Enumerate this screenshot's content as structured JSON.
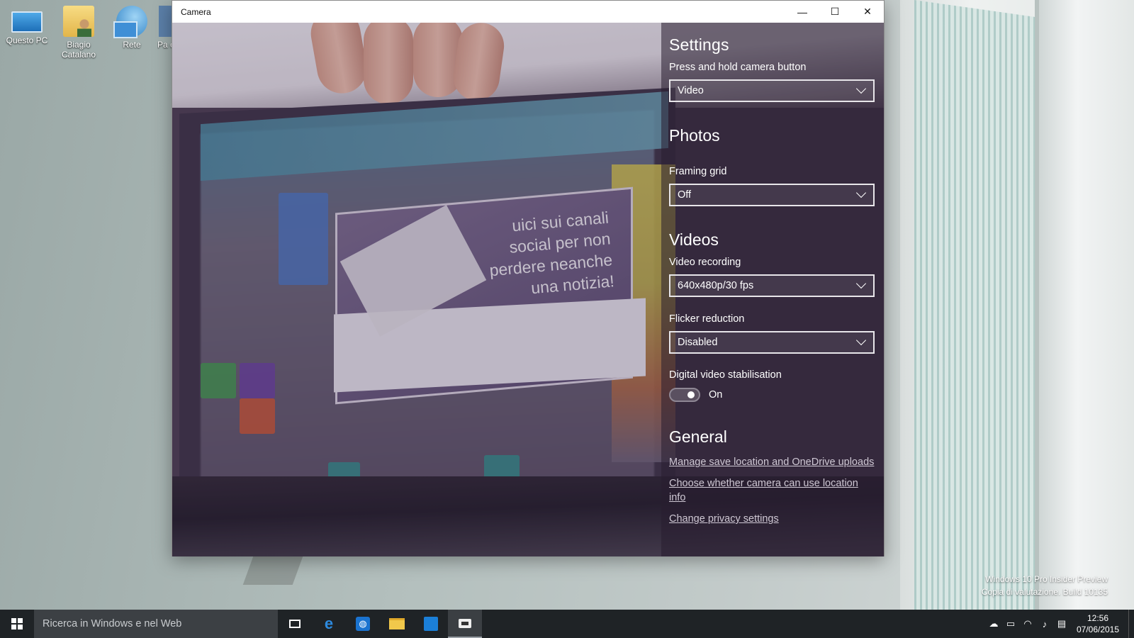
{
  "desktop": {
    "icons": [
      {
        "label": "Questo PC",
        "icon": "computer-icon"
      },
      {
        "label": "Biagio Catalano",
        "icon": "user-folder-icon"
      },
      {
        "label": "Rete",
        "icon": "network-icon"
      },
      {
        "label": "Pa c",
        "icon": "control-panel-icon"
      }
    ],
    "watermark": {
      "line1": "Windows 10 Pro Insider Preview",
      "line2": "Copia di valutazione. Build 10135"
    }
  },
  "window": {
    "title": "Camera",
    "controls": {
      "minimize": "—",
      "maximize": "☐",
      "close": "✕"
    }
  },
  "feed": {
    "popup_text": "uici sui canali social per non perdere neanche una notizia!"
  },
  "settings": {
    "title": "Settings",
    "camera_button_label": "Press and hold camera button",
    "camera_button_value": "Video",
    "photos_heading": "Photos",
    "framing_grid_label": "Framing grid",
    "framing_grid_value": "Off",
    "videos_heading": "Videos",
    "video_recording_label": "Video recording",
    "video_recording_value": "640x480p/30 fps",
    "flicker_label": "Flicker reduction",
    "flicker_value": "Disabled",
    "stabilisation_label": "Digital video stabilisation",
    "stabilisation_state": "On",
    "general_heading": "General",
    "links": {
      "save_location": "Manage save location and OneDrive uploads",
      "location_info": "Choose whether camera can use location info",
      "privacy": "Change privacy settings"
    }
  },
  "taskbar": {
    "search_placeholder": "Ricerca in Windows e nel Web",
    "apps": [
      "task-view-icon",
      "edge-icon",
      "ie-icon",
      "file-explorer-icon",
      "store-icon",
      "camera-icon"
    ],
    "clock": {
      "time": "12:56",
      "date": "07/06/2015"
    }
  }
}
